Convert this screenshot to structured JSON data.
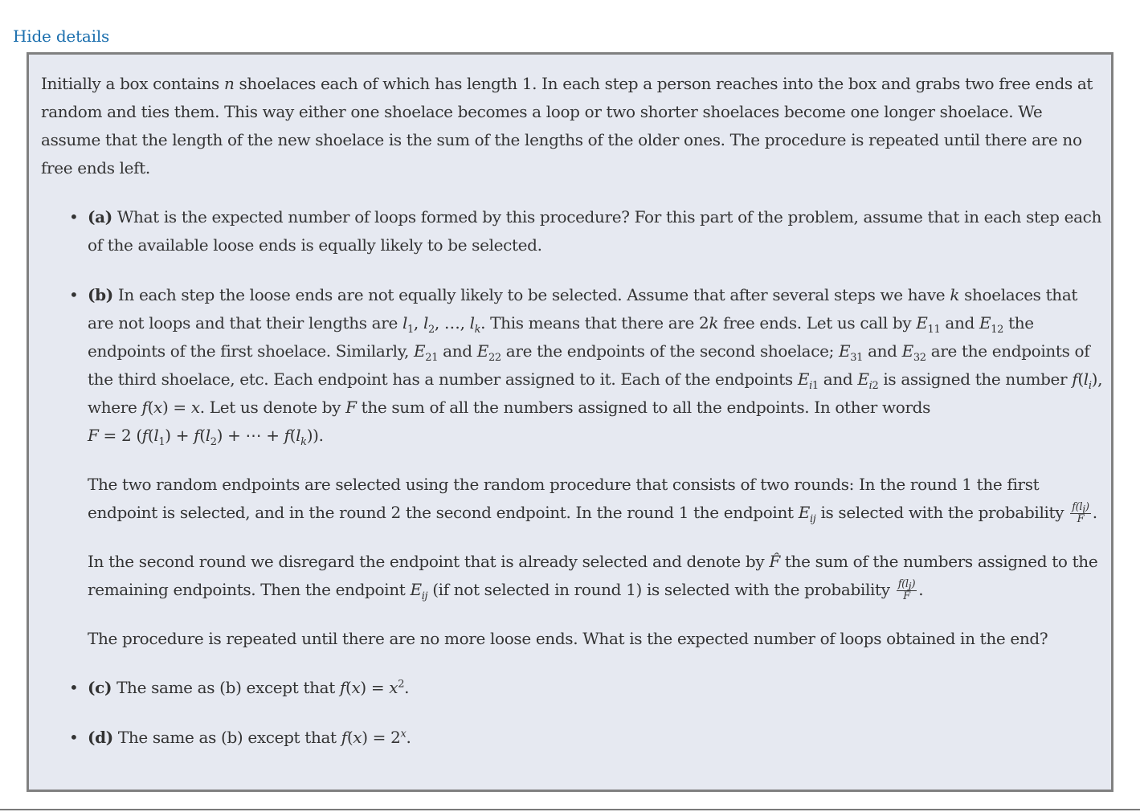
{
  "toggle_label": "Hide details",
  "intro": {
    "t1": "Initially a box contains ",
    "t2": " shoelaces each of which has length ",
    "t3": ". In each step a person reaches into the box and grabs two free ends at random and ties them. This way either one shoelace becomes a loop or two shorter shoelaces become one longer shoelace. We assume that the length of the new shoelace is the sum of the lengths of the older ones. The procedure is repeated until there are no free ends left."
  },
  "part_a": {
    "label": "(a)",
    "text": " What is the expected number of loops formed by this procedure? For this part of the problem, assume that in each step each of the available loose ends is equally likely to be selected."
  },
  "part_b": {
    "label": "(b)",
    "s1": " In each step the loose ends are not equally likely to be selected. Assume that after several steps we have ",
    "s2": " shoelaces that are not loops and that their lengths are ",
    "s3": ". This means that there are ",
    "s4": " free ends. Let us call by ",
    "s5": " and ",
    "s6": " the endpoints of the first shoelace. Similarly, ",
    "s7": " and ",
    "s8": " are the endpoints of the second shoelace; ",
    "s9": " and ",
    "s10": " are the endpoints of the third shoelace, etc. Each endpoint has a number assigned to it. Each of the endpoints ",
    "s11": " and ",
    "s12": " is assigned the number ",
    "s13": ", where ",
    "s14": ". Let us denote by ",
    "s15": " the sum of all the numbers assigned to all the endpoints. In other words",
    "s16": ".",
    "p2a": "The two random endpoints are selected using the random procedure that consists of two rounds: In the round 1 the first endpoint is selected, and in the round 2 the second endpoint. In the round 1 the endpoint ",
    "p2b": " is selected with the probability ",
    "p2c": ".",
    "p3a": "In the second round we disregard the endpoint that is already selected and denote by ",
    "p3b": " the sum of the numbers assigned to the remaining endpoints. Then the endpoint ",
    "p3c": " (if not selected in round 1) is selected with the probability ",
    "p3d": ".",
    "p4": "The procedure is repeated until there are no more loose ends. What is the expected number of loops obtained in the end?"
  },
  "part_c": {
    "label": "(c)",
    "text": " The same as (b) except that ",
    "end": "."
  },
  "part_d": {
    "label": "(d)",
    "text": " The same as (b) except that ",
    "end": "."
  }
}
